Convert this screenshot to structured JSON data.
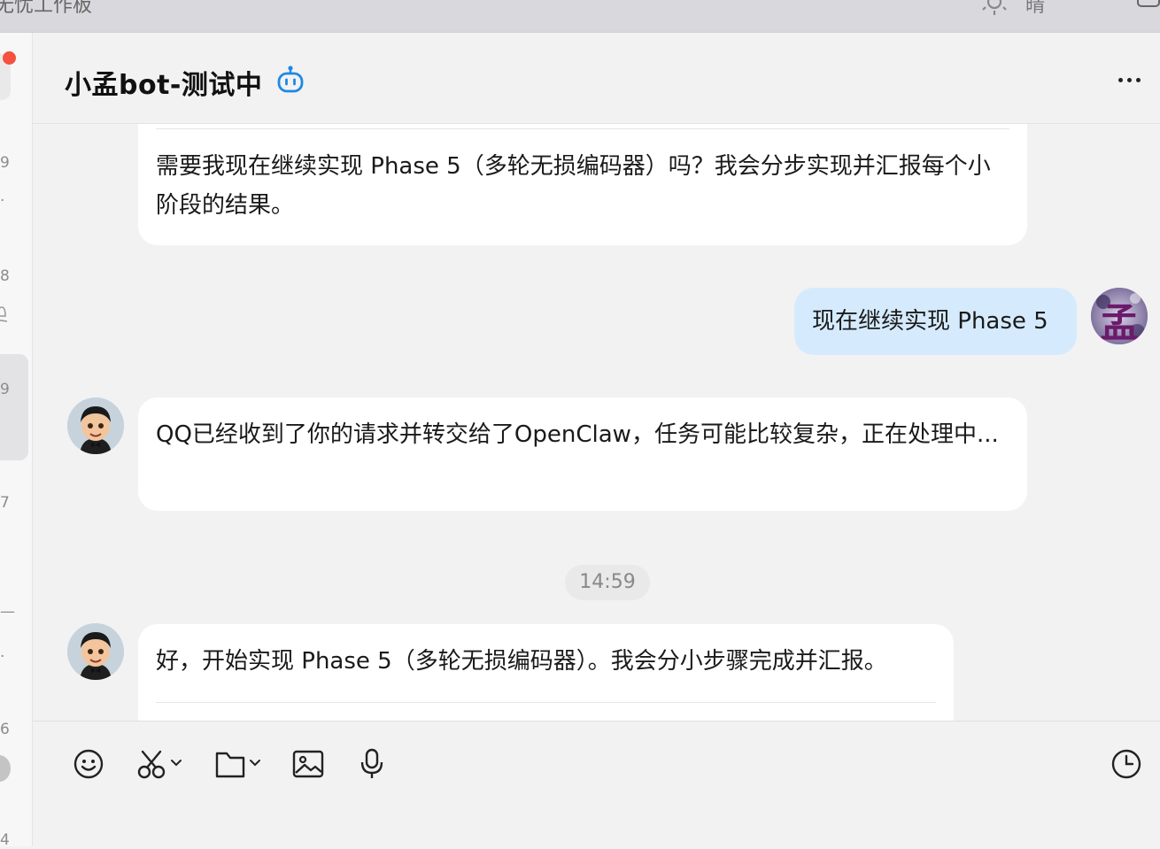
{
  "topbar": {
    "cut_left_text": "无忧工作板",
    "cut_weather_text": "晴"
  },
  "sidebar": {
    "fragments": [
      "9",
      "·",
      "8",
      "9",
      "7",
      "—",
      "·",
      "6",
      "4"
    ]
  },
  "chat": {
    "title": "小孟bot-测试中",
    "messages": [
      {
        "sender": "bot",
        "text": "需要我现在继续实现 Phase 5（多轮无损编码器）吗？我会分步实现并汇报每个小阶段的结果。"
      },
      {
        "sender": "user",
        "text": "现在继续实现 Phase 5",
        "avatar_char": "孟"
      },
      {
        "sender": "bot",
        "text": "QQ已经收到了你的请求并转交给了OpenClaw，任务可能比较复杂，正在处理中..."
      },
      {
        "sender": "bot",
        "text": "好，开始实现 Phase 5（多轮无损编码器）。我会分小步骤完成并汇报。"
      }
    ],
    "time_divider": "14:59"
  },
  "composer": {
    "tools": [
      "emoji-icon",
      "scissors-icon",
      "folder-icon",
      "image-icon",
      "microphone-icon"
    ],
    "right_tool": "clock-icon"
  },
  "colors": {
    "user_bubble": "#d5ebfd",
    "bot_bubble": "#ffffff",
    "accent": "#1e88e5",
    "unread_dot": "#f4513e"
  }
}
